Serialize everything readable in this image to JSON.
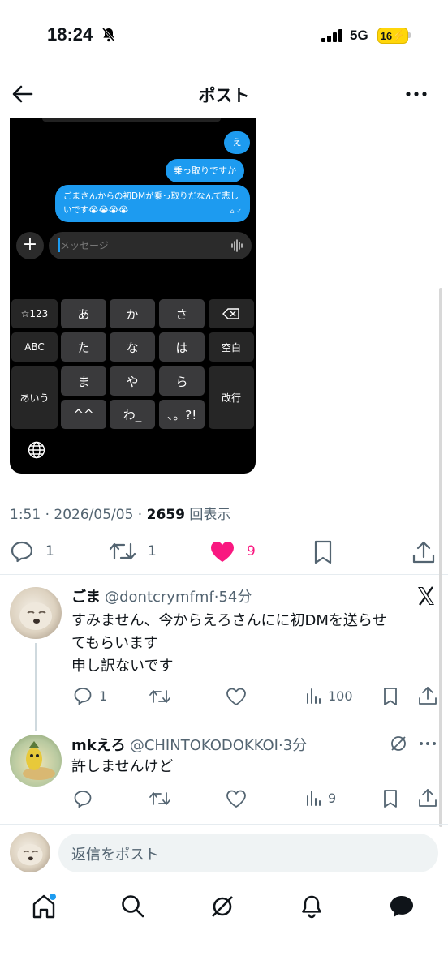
{
  "status_bar": {
    "time": "18:24",
    "network": "5G",
    "battery": "16"
  },
  "header": {
    "title": "ポスト"
  },
  "media": {
    "bubbles": [
      "え",
      "乗っ取りですか",
      "ごまさんからの初DMが乗っ取りだなんて悲しいです😭😭😭😭"
    ],
    "composer_placeholder": "メッセージ",
    "keyboard": {
      "row1": [
        "☆123",
        "あ",
        "か",
        "さ"
      ],
      "row2": [
        "ABC",
        "た",
        "な",
        "は",
        "空白"
      ],
      "row3": [
        "あいう",
        "ま",
        "や",
        "ら",
        "改行"
      ],
      "row4": [
        "^^",
        "わ_",
        "、。?!"
      ]
    }
  },
  "post_meta": {
    "time": "1:51",
    "date": "2026/05/05",
    "views": "2659",
    "views_label": "回表示"
  },
  "actions": {
    "replies": "1",
    "reposts": "1",
    "likes": "9"
  },
  "replies": [
    {
      "name": "ごま",
      "handle": "@dontcrymfmf",
      "time": "54分",
      "text_lines": [
        "すみません、今からえろさんにに初DMを送らせ",
        "てもらいます",
        "申し訳ないです"
      ],
      "reply_count": "1",
      "views": "100"
    },
    {
      "name": "mkえろ",
      "handle": "@CHINTOKODOKKOI",
      "time": "3分",
      "text_lines": [
        "許しませんけど"
      ],
      "views": "9"
    }
  ],
  "reply_bar": {
    "placeholder": "返信をポスト"
  },
  "colors": {
    "accent": "#1d9bf0",
    "like": "#f91880",
    "text": "#0f1419",
    "muted": "#536471"
  }
}
